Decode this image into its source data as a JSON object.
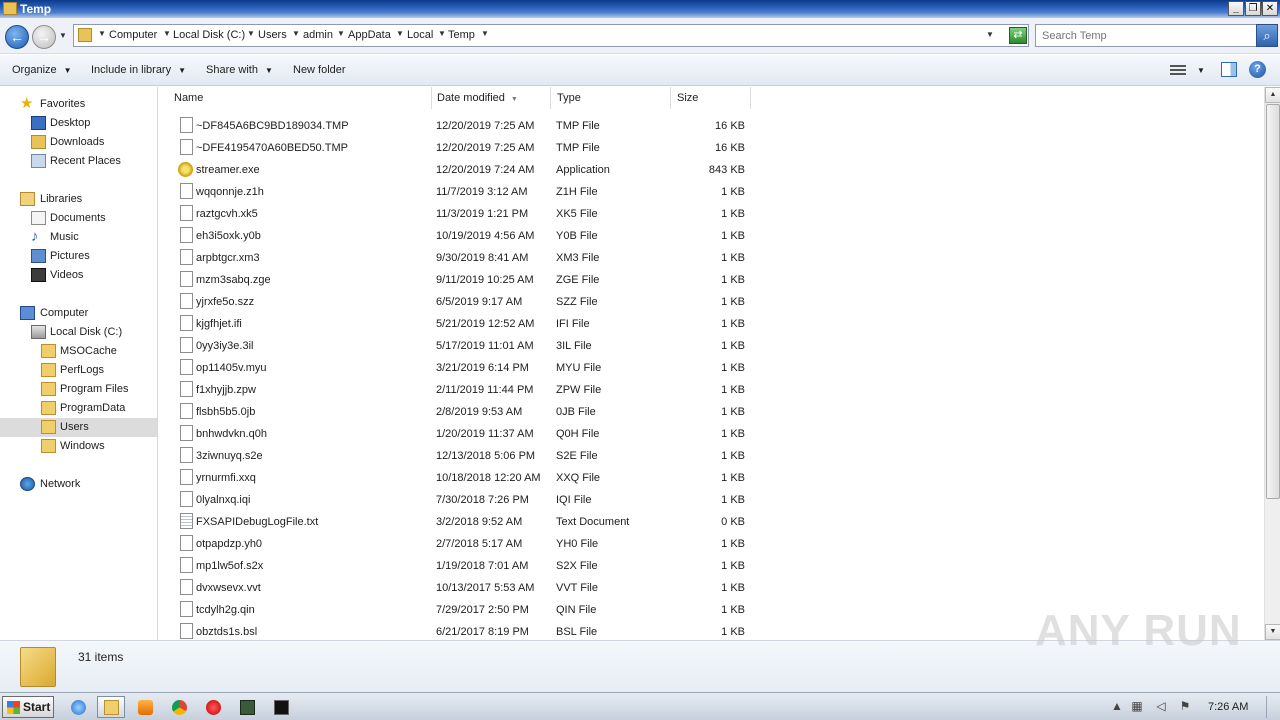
{
  "window": {
    "title": "Temp"
  },
  "address": {
    "crumbs": [
      "Computer",
      "Local Disk (C:)",
      "Users",
      "admin",
      "AppData",
      "Local",
      "Temp"
    ]
  },
  "search": {
    "placeholder": "Search Temp"
  },
  "toolbar": {
    "organize": "Organize",
    "include": "Include in library",
    "share": "Share with",
    "new_folder": "New folder"
  },
  "nav": {
    "favorites": "Favorites",
    "desktop": "Desktop",
    "downloads": "Downloads",
    "recent": "Recent Places",
    "libraries": "Libraries",
    "documents": "Documents",
    "music": "Music",
    "pictures": "Pictures",
    "videos": "Videos",
    "computer": "Computer",
    "localdisk": "Local Disk (C:)",
    "msocache": "MSOCache",
    "perflogs": "PerfLogs",
    "programfiles": "Program Files",
    "programdata": "ProgramData",
    "users": "Users",
    "windows": "Windows",
    "network": "Network"
  },
  "columns": {
    "name": "Name",
    "date": "Date modified",
    "type": "Type",
    "size": "Size"
  },
  "files": [
    {
      "name": "~DF845A6BC9BD189034.TMP",
      "date": "12/20/2019 7:25 AM",
      "type": "TMP File",
      "size": "16 KB",
      "icon": "file"
    },
    {
      "name": "~DFE4195470A60BED50.TMP",
      "date": "12/20/2019 7:25 AM",
      "type": "TMP File",
      "size": "16 KB",
      "icon": "file"
    },
    {
      "name": "streamer.exe",
      "date": "12/20/2019 7:24 AM",
      "type": "Application",
      "size": "843 KB",
      "icon": "app"
    },
    {
      "name": "wqqonnje.z1h",
      "date": "11/7/2019 3:12 AM",
      "type": "Z1H File",
      "size": "1 KB",
      "icon": "file"
    },
    {
      "name": "raztgcvh.xk5",
      "date": "11/3/2019 1:21 PM",
      "type": "XK5 File",
      "size": "1 KB",
      "icon": "file"
    },
    {
      "name": "eh3i5oxk.y0b",
      "date": "10/19/2019 4:56 AM",
      "type": "Y0B File",
      "size": "1 KB",
      "icon": "file"
    },
    {
      "name": "arpbtgcr.xm3",
      "date": "9/30/2019 8:41 AM",
      "type": "XM3 File",
      "size": "1 KB",
      "icon": "file"
    },
    {
      "name": "mzm3sabq.zge",
      "date": "9/11/2019 10:25 AM",
      "type": "ZGE File",
      "size": "1 KB",
      "icon": "file"
    },
    {
      "name": "yjrxfe5o.szz",
      "date": "6/5/2019 9:17 AM",
      "type": "SZZ File",
      "size": "1 KB",
      "icon": "file"
    },
    {
      "name": "kjgfhjet.ifi",
      "date": "5/21/2019 12:52 AM",
      "type": "IFI File",
      "size": "1 KB",
      "icon": "file"
    },
    {
      "name": "0yy3iy3e.3il",
      "date": "5/17/2019 11:01 AM",
      "type": "3IL File",
      "size": "1 KB",
      "icon": "file"
    },
    {
      "name": "op11405v.myu",
      "date": "3/21/2019 6:14 PM",
      "type": "MYU File",
      "size": "1 KB",
      "icon": "file"
    },
    {
      "name": "f1xhyjjb.zpw",
      "date": "2/11/2019 11:44 PM",
      "type": "ZPW File",
      "size": "1 KB",
      "icon": "file"
    },
    {
      "name": "flsbh5b5.0jb",
      "date": "2/8/2019 9:53 AM",
      "type": "0JB File",
      "size": "1 KB",
      "icon": "file"
    },
    {
      "name": "bnhwdvkn.q0h",
      "date": "1/20/2019 11:37 AM",
      "type": "Q0H File",
      "size": "1 KB",
      "icon": "file"
    },
    {
      "name": "3ziwnuyq.s2e",
      "date": "12/13/2018 5:06 PM",
      "type": "S2E File",
      "size": "1 KB",
      "icon": "file"
    },
    {
      "name": "yrnurmfi.xxq",
      "date": "10/18/2018 12:20 AM",
      "type": "XXQ File",
      "size": "1 KB",
      "icon": "file"
    },
    {
      "name": "0lyalnxq.iqi",
      "date": "7/30/2018 7:26 PM",
      "type": "IQI File",
      "size": "1 KB",
      "icon": "file"
    },
    {
      "name": "FXSAPIDebugLogFile.txt",
      "date": "3/2/2018 9:52 AM",
      "type": "Text Document",
      "size": "0 KB",
      "icon": "txt"
    },
    {
      "name": "otpapdzp.yh0",
      "date": "2/7/2018 5:17 AM",
      "type": "YH0 File",
      "size": "1 KB",
      "icon": "file"
    },
    {
      "name": "mp1lw5of.s2x",
      "date": "1/19/2018 7:01 AM",
      "type": "S2X File",
      "size": "1 KB",
      "icon": "file"
    },
    {
      "name": "dvxwsevx.vvt",
      "date": "10/13/2017 5:53 AM",
      "type": "VVT File",
      "size": "1 KB",
      "icon": "file"
    },
    {
      "name": "tcdylh2g.qin",
      "date": "7/29/2017 2:50 PM",
      "type": "QIN File",
      "size": "1 KB",
      "icon": "file"
    },
    {
      "name": "obztds1s.bsl",
      "date": "6/21/2017 8:19 PM",
      "type": "BSL File",
      "size": "1 KB",
      "icon": "file"
    }
  ],
  "details": {
    "count": "31 items"
  },
  "watermark": "ANY RUN",
  "taskbar": {
    "start": "Start",
    "clock": "7:26 AM"
  }
}
